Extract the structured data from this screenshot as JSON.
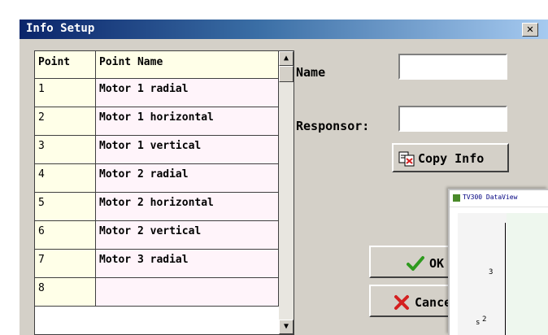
{
  "window": {
    "title": "Info Setup",
    "close_glyph": "✕"
  },
  "table": {
    "headers": [
      "Point",
      "Point Name"
    ],
    "rows": [
      {
        "point": "1",
        "name": "Motor 1 radial"
      },
      {
        "point": "2",
        "name": "Motor 1 horizontal"
      },
      {
        "point": "3",
        "name": "Motor 1 vertical"
      },
      {
        "point": "4",
        "name": "Motor 2 radial"
      },
      {
        "point": "5",
        "name": "Motor 2 horizontal"
      },
      {
        "point": "6",
        "name": "Motor 2 vertical"
      },
      {
        "point": "7",
        "name": "Motor 3 radial"
      },
      {
        "point": "8",
        "name": ""
      }
    ]
  },
  "form": {
    "name_label": "Name",
    "name_value": "",
    "responsor_label": "Responsor:",
    "responsor_value": ""
  },
  "buttons": {
    "copy_info": "Copy Info",
    "ok": "OK",
    "cancel": "Cancel"
  },
  "overlay": {
    "title": "TV300 DataView",
    "tick_3": "3",
    "tick_2": "2",
    "axis_letter": "s"
  },
  "colors": {
    "title_start": "#0a246a",
    "title_end": "#a6caf0",
    "ok_check": "#2e9a1e",
    "cancel_x": "#d42020",
    "grid_header_bg": "#ffffe8"
  }
}
